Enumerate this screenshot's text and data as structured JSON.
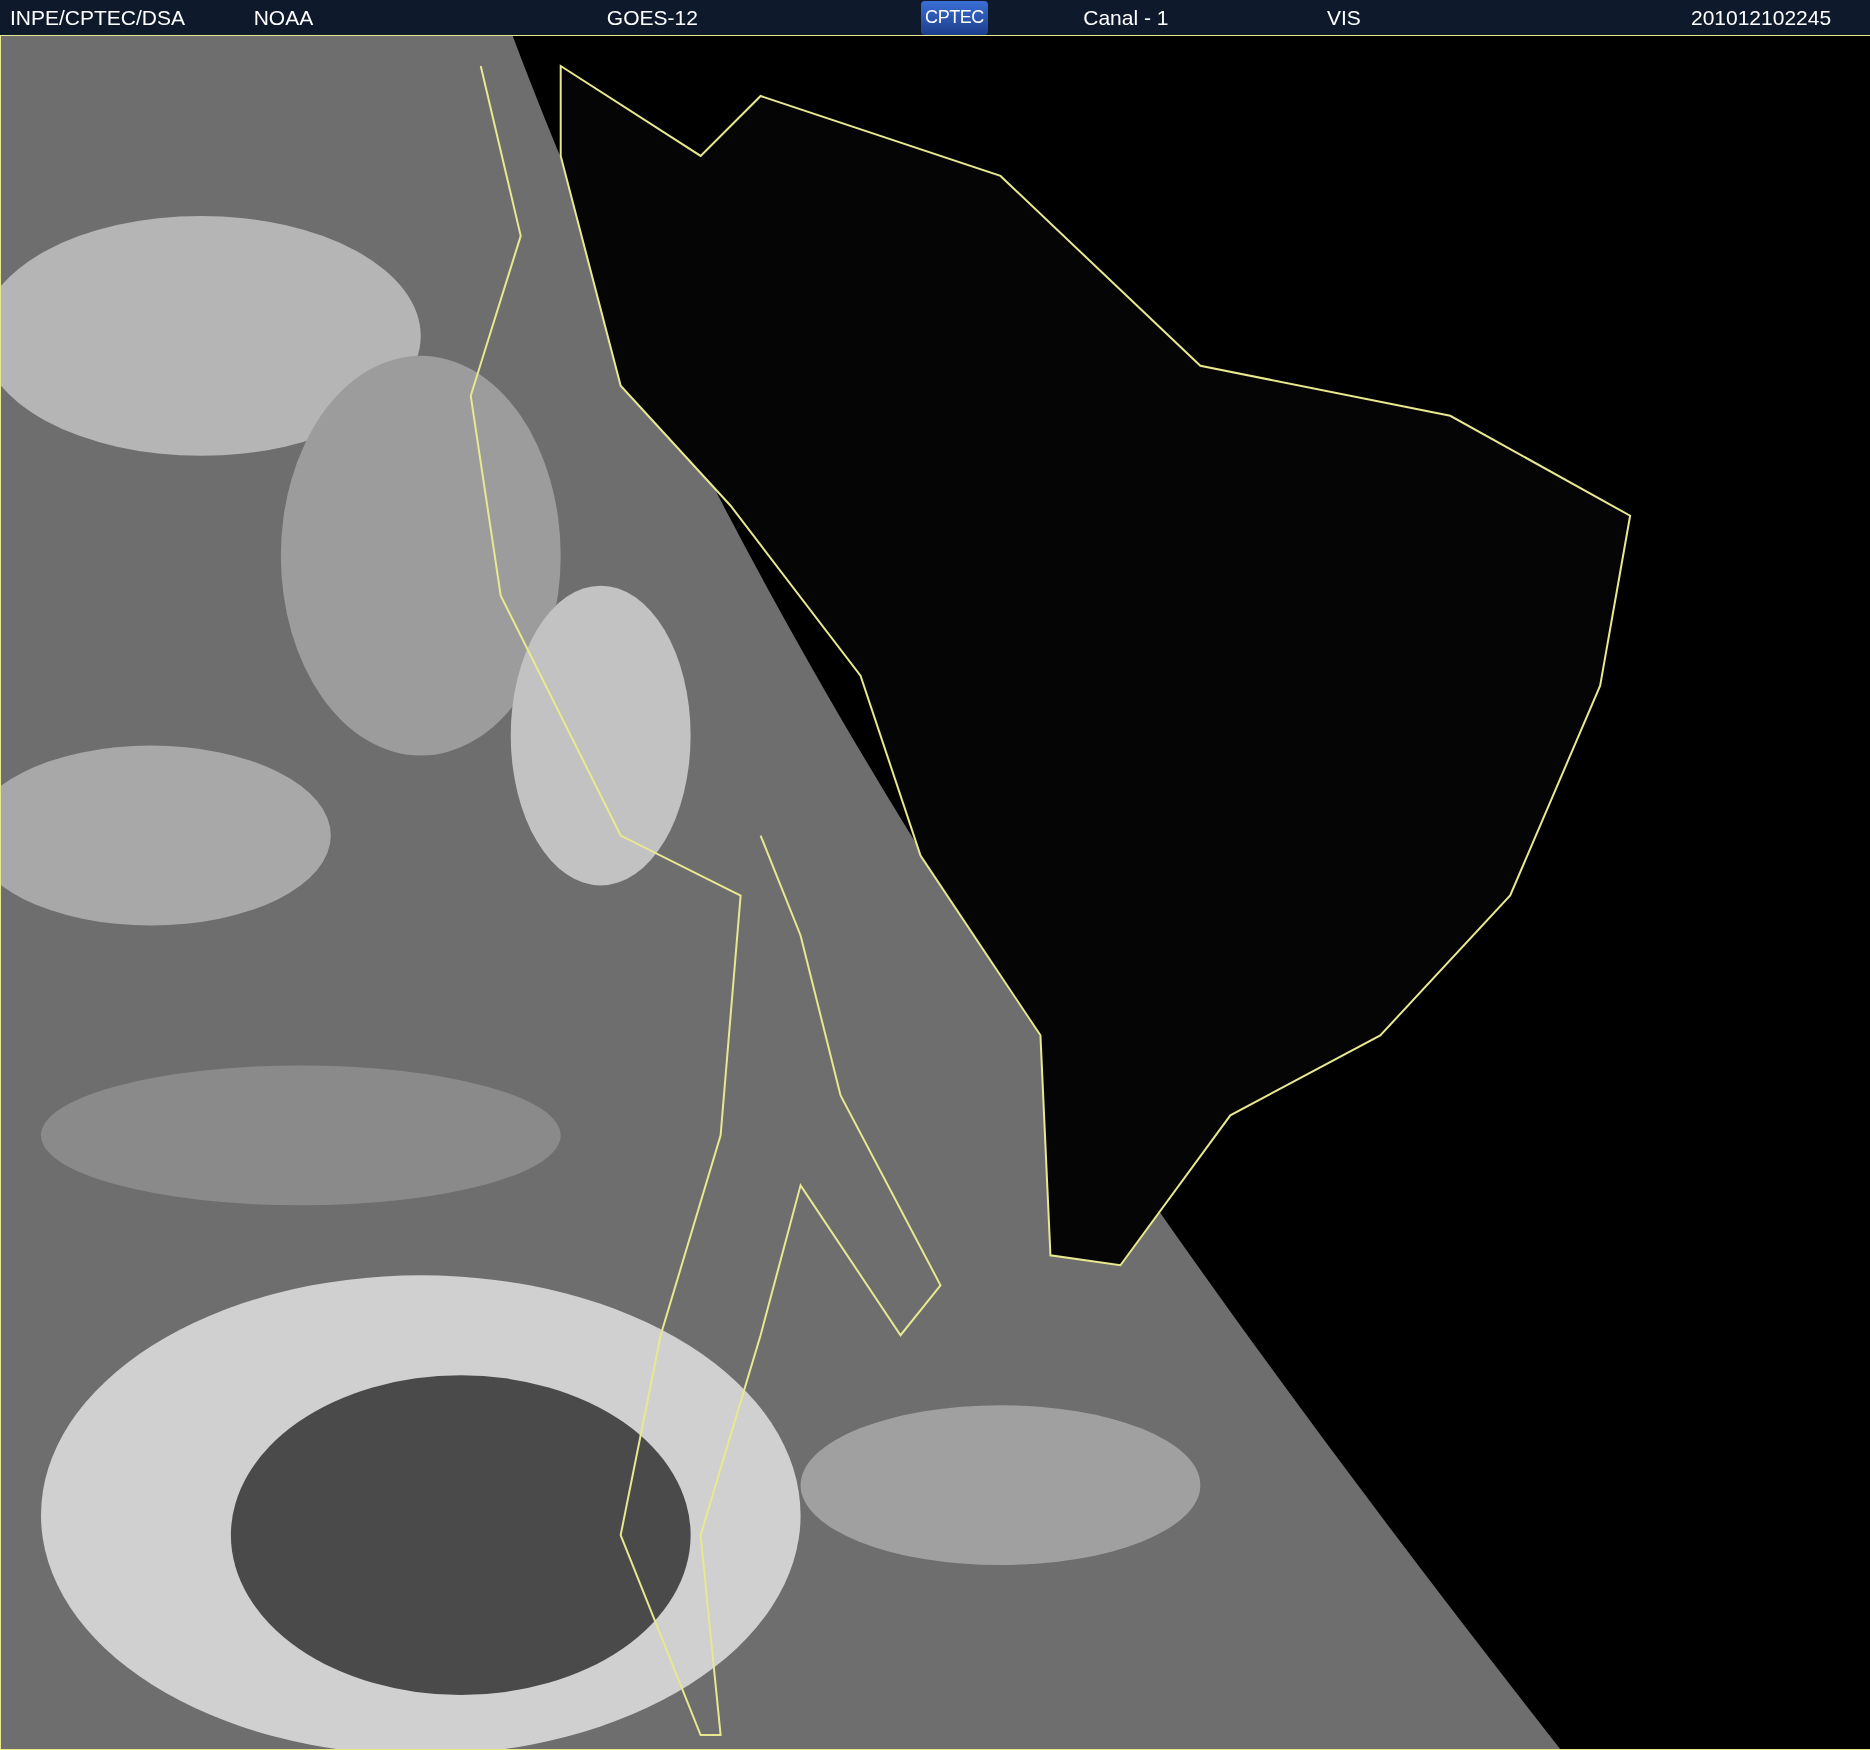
{
  "header": {
    "items": [
      {
        "kind": "text",
        "text": "INPE/CPTEC/DSA"
      },
      {
        "kind": "text",
        "text": "NOAA"
      },
      {
        "kind": "text",
        "text": "GOES-12"
      },
      {
        "kind": "logo",
        "text": "CPTEC"
      },
      {
        "kind": "text",
        "text": "Canal - 1"
      },
      {
        "kind": "text",
        "text": "VIS"
      },
      {
        "kind": "text",
        "text": "201012102245"
      }
    ]
  }
}
